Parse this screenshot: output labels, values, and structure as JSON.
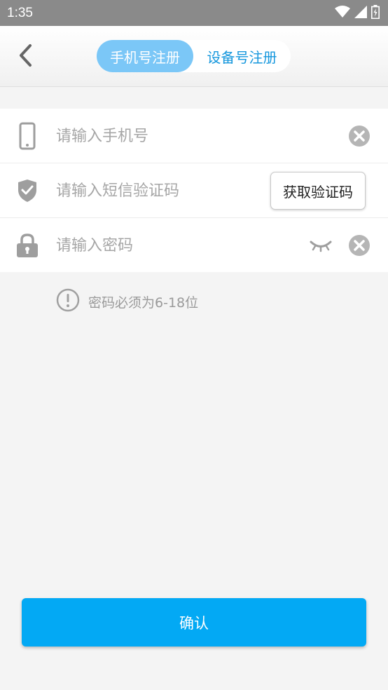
{
  "status_bar": {
    "time": "1:35",
    "icons": [
      "wifi-icon",
      "signal-icon",
      "battery-icon"
    ]
  },
  "header": {
    "back_icon": "chevron-left-icon",
    "tabs": [
      {
        "label": "手机号注册",
        "active": true
      },
      {
        "label": "设备号注册",
        "active": false
      }
    ]
  },
  "form": {
    "phone": {
      "placeholder": "请输入手机号",
      "value": "",
      "icon": "phone-icon"
    },
    "sms": {
      "placeholder": "请输入短信验证码",
      "value": "",
      "icon": "shield-check-icon",
      "button_label": "获取验证码"
    },
    "password": {
      "placeholder": "请输入密码",
      "value": "",
      "icon": "lock-icon"
    }
  },
  "hint": {
    "text": "密码必须为6-18位",
    "icon": "exclamation-circle-icon"
  },
  "confirm": {
    "label": "确认"
  },
  "colors": {
    "accent": "#03a9f4",
    "tab_active_bg": "#7bc7f7",
    "tab_inactive_text": "#1597dd",
    "status_bar": "#8a8a8a",
    "icon_gray": "#9e9e9e"
  }
}
